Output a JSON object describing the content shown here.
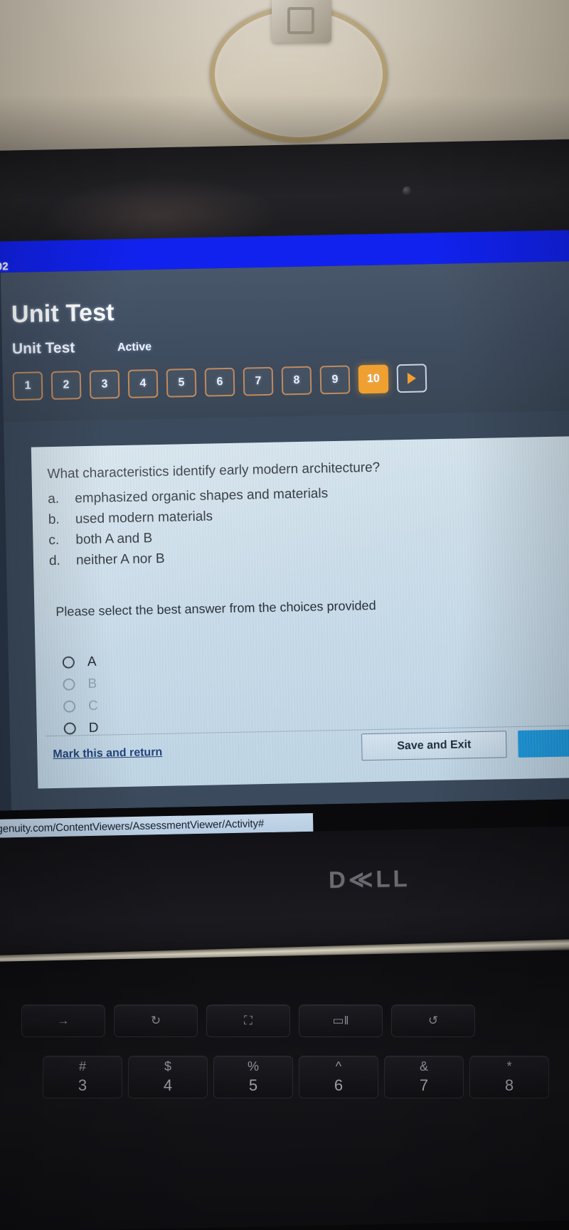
{
  "photo": {
    "scene": "photo of a Dell laptop screen showing an online Unit Test",
    "wall_fixture": "towel-ring"
  },
  "browser": {
    "tab_label_fragment": "02",
    "status_url": "lgenuity.com/ContentViewers/AssessmentViewer/Activity#"
  },
  "app": {
    "title": "Unit Test",
    "subtitle": "Unit Test",
    "status": "Active",
    "accent_orange": "#f0a030",
    "accent_blue": "#1122ee",
    "question_nav": [
      {
        "label": "1",
        "state": "visited"
      },
      {
        "label": "2",
        "state": "visited"
      },
      {
        "label": "3",
        "state": "visited"
      },
      {
        "label": "4",
        "state": "visited"
      },
      {
        "label": "5",
        "state": "visited"
      },
      {
        "label": "6",
        "state": "visited"
      },
      {
        "label": "7",
        "state": "visited"
      },
      {
        "label": "8",
        "state": "visited"
      },
      {
        "label": "9",
        "state": "visited"
      },
      {
        "label": "10",
        "state": "current"
      }
    ],
    "next_button_label": "next-question"
  },
  "question": {
    "prompt": "What characteristics identify early modern architecture?",
    "options": [
      {
        "letter": "a.",
        "text": "emphasized organic shapes and materials"
      },
      {
        "letter": "b.",
        "text": "used modern materials"
      },
      {
        "letter": "c.",
        "text": "both A and B"
      },
      {
        "letter": "d.",
        "text": "neither A nor B"
      }
    ],
    "instruction": "Please select the best answer from the choices provided",
    "choices": [
      {
        "label": "A",
        "selected": false,
        "dim": false
      },
      {
        "label": "B",
        "selected": false,
        "dim": true
      },
      {
        "label": "C",
        "selected": false,
        "dim": true
      },
      {
        "label": "D",
        "selected": false,
        "dim": false
      }
    ]
  },
  "footer": {
    "mark_link": "Mark this and return",
    "save_button": "Save and Exit",
    "next_button": ""
  },
  "laptop": {
    "brand": "D≪LL",
    "fn_keys": [
      "→",
      "↻",
      "⛶",
      "▭‖",
      "↺"
    ],
    "number_keys": [
      {
        "top": "#",
        "bot": "3"
      },
      {
        "top": "$",
        "bot": "4"
      },
      {
        "top": "%",
        "bot": "5"
      },
      {
        "top": "^",
        "bot": "6"
      },
      {
        "top": "&",
        "bot": "7"
      },
      {
        "top": "*",
        "bot": "8"
      }
    ]
  }
}
